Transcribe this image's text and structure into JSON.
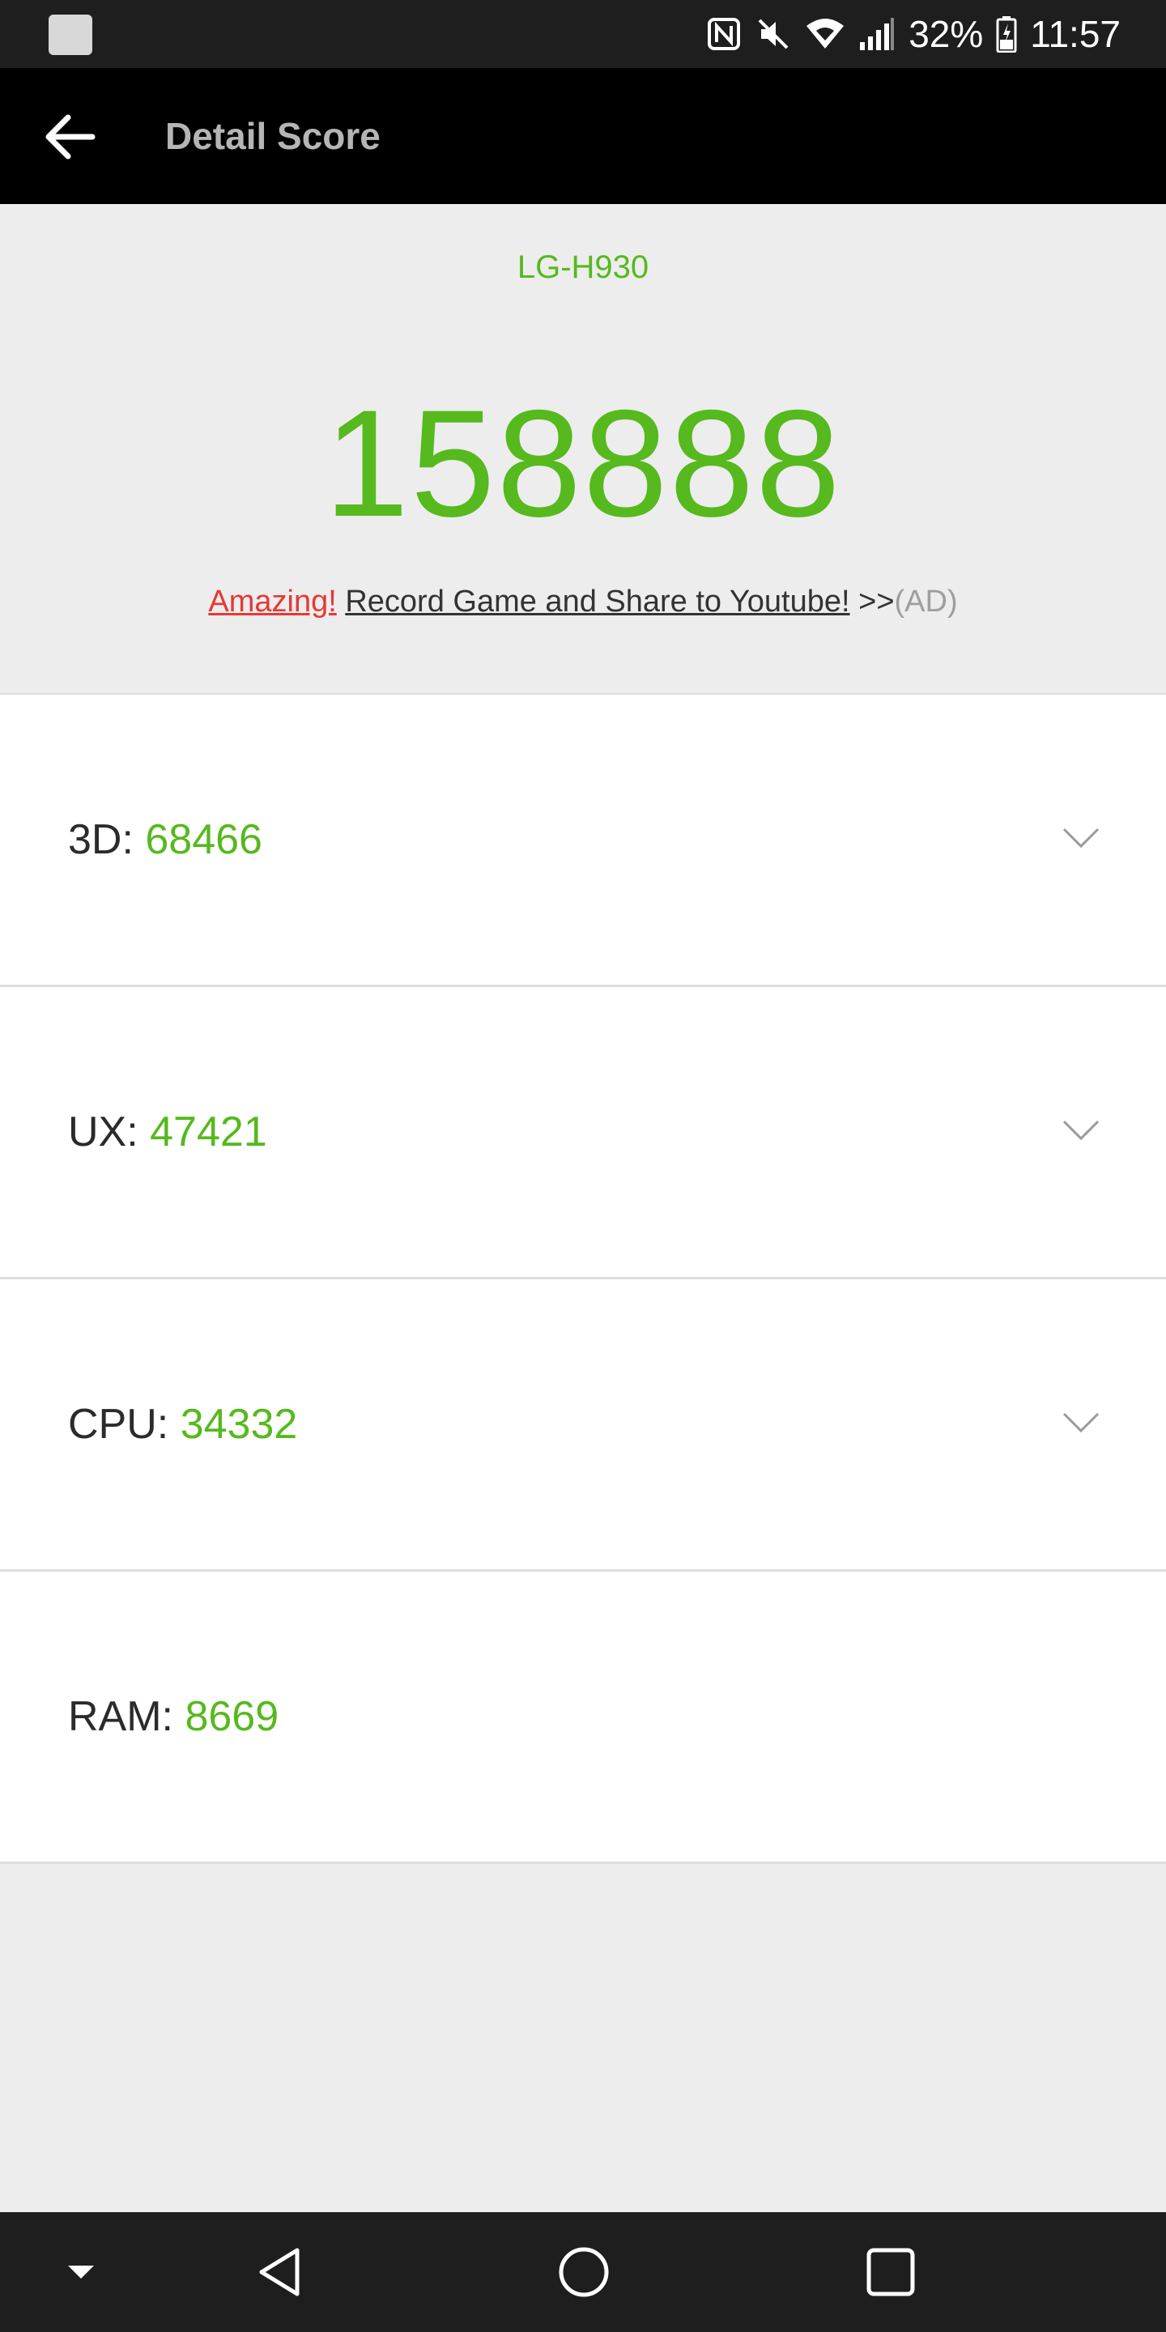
{
  "status_bar": {
    "battery": "32%",
    "time": "11:57",
    "icons": [
      "notification-square-icon",
      "nfc-icon",
      "mute-icon",
      "wifi-icon",
      "signal-icon",
      "battery-icon"
    ]
  },
  "app_bar": {
    "title": "Detail Score",
    "back_icon": "arrow-left-icon"
  },
  "summary": {
    "device": "LG-H930",
    "total_score": "158888",
    "ad": {
      "amazing": "Amazing!",
      "link_text": "Record Game and Share to Youtube!",
      "arrows": ">>",
      "tag": "(AD)"
    }
  },
  "scores": [
    {
      "label": "3D:",
      "value": "68466",
      "expandable": true
    },
    {
      "label": "UX:",
      "value": "47421",
      "expandable": true
    },
    {
      "label": "CPU:",
      "value": "34332",
      "expandable": true
    },
    {
      "label": "RAM:",
      "value": "8669",
      "expandable": false
    }
  ],
  "nav_bar": {
    "buttons": [
      "hide-keyboard-icon",
      "back-triangle-icon",
      "home-circle-icon",
      "recents-square-icon"
    ]
  },
  "colors": {
    "accent_green": "#56b91e",
    "ad_red": "#e53935",
    "app_bar": "#000000",
    "background": "#ededed"
  }
}
